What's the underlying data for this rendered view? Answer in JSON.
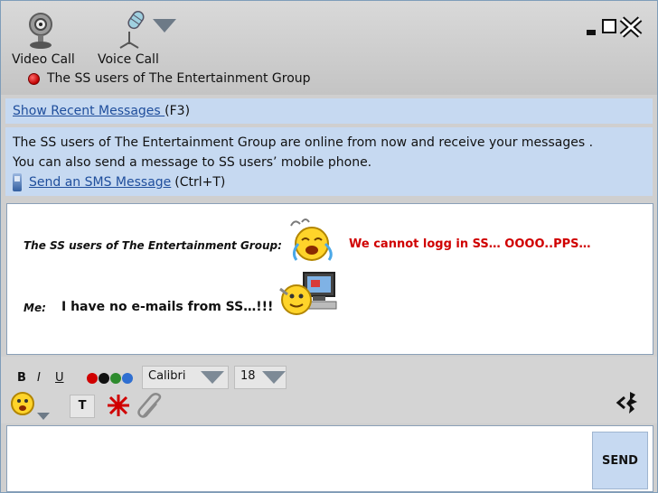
{
  "toolbar": {
    "video_call_label": "Video Call",
    "voice_call_label": "Voice Call"
  },
  "contact": {
    "name": "The SS users of The Entertainment Group",
    "status_color": "#cc0000"
  },
  "recent": {
    "link": "Show Recent Messages ",
    "shortcut": "(F3)"
  },
  "info": {
    "line1": "The SS users of The Entertainment Group are online from now and receive your messages .",
    "line2": "You can also send a message to SS users’ mobile phone.",
    "sms_link": "Send an SMS Message ",
    "sms_shortcut": "(Ctrl+T)"
  },
  "conversation": {
    "sender1": "The SS users of The Entertainment Group:",
    "message1": "We cannot logg in SS… OOOO..PPS…",
    "sender2": "Me:",
    "message2": "I have no e-mails from SS…!!!"
  },
  "format": {
    "bold": "B",
    "italic": "I",
    "underline": "U",
    "font": "Calibri",
    "size": "18",
    "text_button": "T",
    "colors": [
      "#d00000",
      "#111111",
      "#2e8b2e",
      "#2f6fd1"
    ]
  },
  "send_label": "SEND",
  "icons": [
    "webcam-icon",
    "microphone-icon",
    "minimize-icon",
    "maximize-icon",
    "close-icon",
    "mobile-phone-icon",
    "emoticon-icon",
    "attachment-icon",
    "nudge-icon",
    "block-icon"
  ]
}
